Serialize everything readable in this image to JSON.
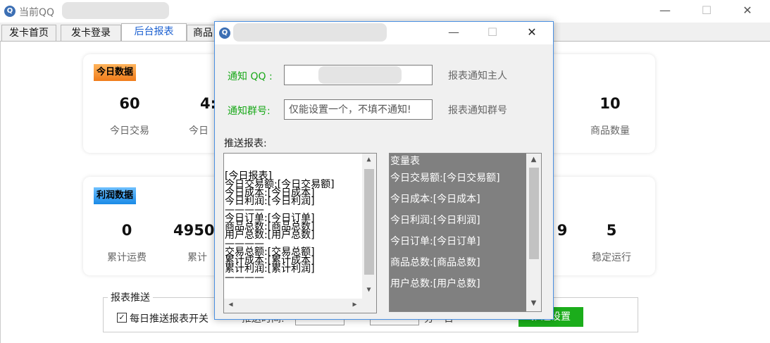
{
  "window": {
    "title": "当前QQ",
    "controls": {
      "minimize": "—",
      "maximize": "☐",
      "close": "✕"
    }
  },
  "tabs": [
    "发卡首页",
    "发卡登录",
    "后台报表",
    "商品"
  ],
  "today": {
    "badge": "今日数据",
    "stats": [
      {
        "value": "60",
        "label": "今日交易"
      },
      {
        "value": "4:",
        "label": "今日"
      },
      {
        "value": "10",
        "label": "商品数量"
      }
    ]
  },
  "profit": {
    "badge": "利润数据",
    "stats": [
      {
        "value": "0",
        "label": "累计运费"
      },
      {
        "value": "4950",
        "label": "累计"
      },
      {
        "value": "9",
        "label": ""
      },
      {
        "value": "5",
        "label": "稳定运行"
      }
    ]
  },
  "report_push": {
    "group_title": "报表推送",
    "daily_switch_label": "每日推送报表开关",
    "daily_switch_checked": true,
    "time_label": "推送时间:",
    "suffix": "分一日",
    "save_button": "推送设置"
  },
  "dialog": {
    "title": "",
    "notify_qq": {
      "label": "通知 QQ :",
      "value": "",
      "hint": "报表通知主人"
    },
    "notify_group": {
      "label": "通知群号:",
      "placeholder": "仅能设置一个，不填不通知!",
      "hint": "报表通知群号"
    },
    "push_report_label": "推送报表:",
    "template_lines": [
      "[今日报表]",
      "今日交易额:[今日交易额]",
      "今日成本:[今日成本]",
      "今日利润:[今日利润]",
      "————",
      "今日订单:[今日订单]",
      "商品总数:[商品总数]",
      "用户总数:[用户总数]",
      "————",
      "交易总额:[交易总额]",
      "累计成本:[累计成本]",
      "累计利润:[累计利润]",
      "————"
    ],
    "variables": [
      "变量表",
      "今日交易额:[今日交易额]",
      "今日成本:[今日成本]",
      "今日利润:[今日利润]",
      "今日订单:[今日订单]",
      "商品总数:[商品总数]",
      "用户总数:[用户总数]"
    ]
  }
}
